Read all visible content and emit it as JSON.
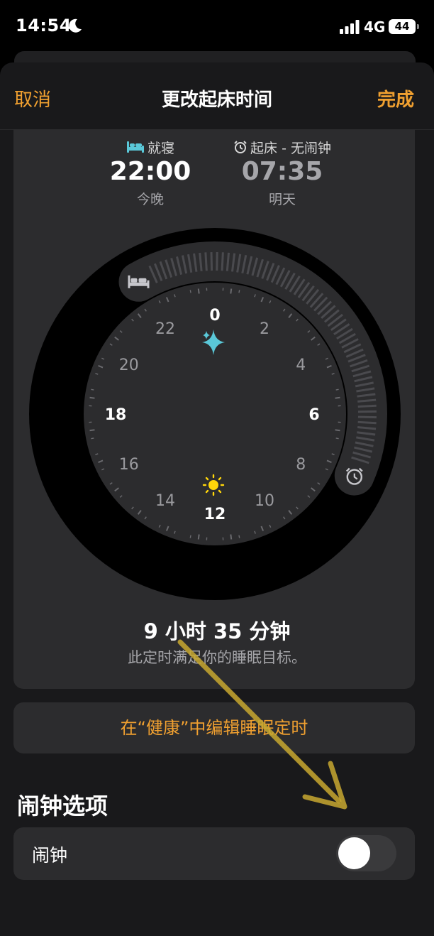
{
  "status_bar": {
    "time": "14:54",
    "network": "4G",
    "battery": "44",
    "icons": [
      "moon-icon",
      "signal-icon"
    ]
  },
  "nav": {
    "cancel": "取消",
    "title": "更改起床时间",
    "done": "完成"
  },
  "bedtime": {
    "label": "就寝",
    "time": "22:00",
    "day": "今晚",
    "icon": "bed-icon",
    "accent": "#5ac8d8"
  },
  "wake": {
    "label": "起床 - 无闹钟",
    "time": "07:35",
    "day": "明天",
    "icon": "alarm-clock-icon"
  },
  "clock": {
    "hour_labels": [
      "0",
      "2",
      "4",
      "6",
      "8",
      "10",
      "12",
      "14",
      "16",
      "18",
      "20",
      "22"
    ],
    "bedtime_hour": 22,
    "wake_hour": 7.583,
    "icons": [
      "sparkle-icon",
      "sun-icon"
    ],
    "sparkle_color": "#5ac8d8",
    "sun_color": "#ffd60a"
  },
  "summary": {
    "duration": "9 小时 35 分钟",
    "goal": "此定时满足你的睡眠目标。"
  },
  "edit_link": "在“健康”中编辑睡眠定时",
  "alarm_section": {
    "title": "闹钟选项",
    "alarm_label": "闹钟",
    "alarm_on": false
  },
  "colors": {
    "accent": "#f0a030",
    "arrow": "#c8a830"
  }
}
